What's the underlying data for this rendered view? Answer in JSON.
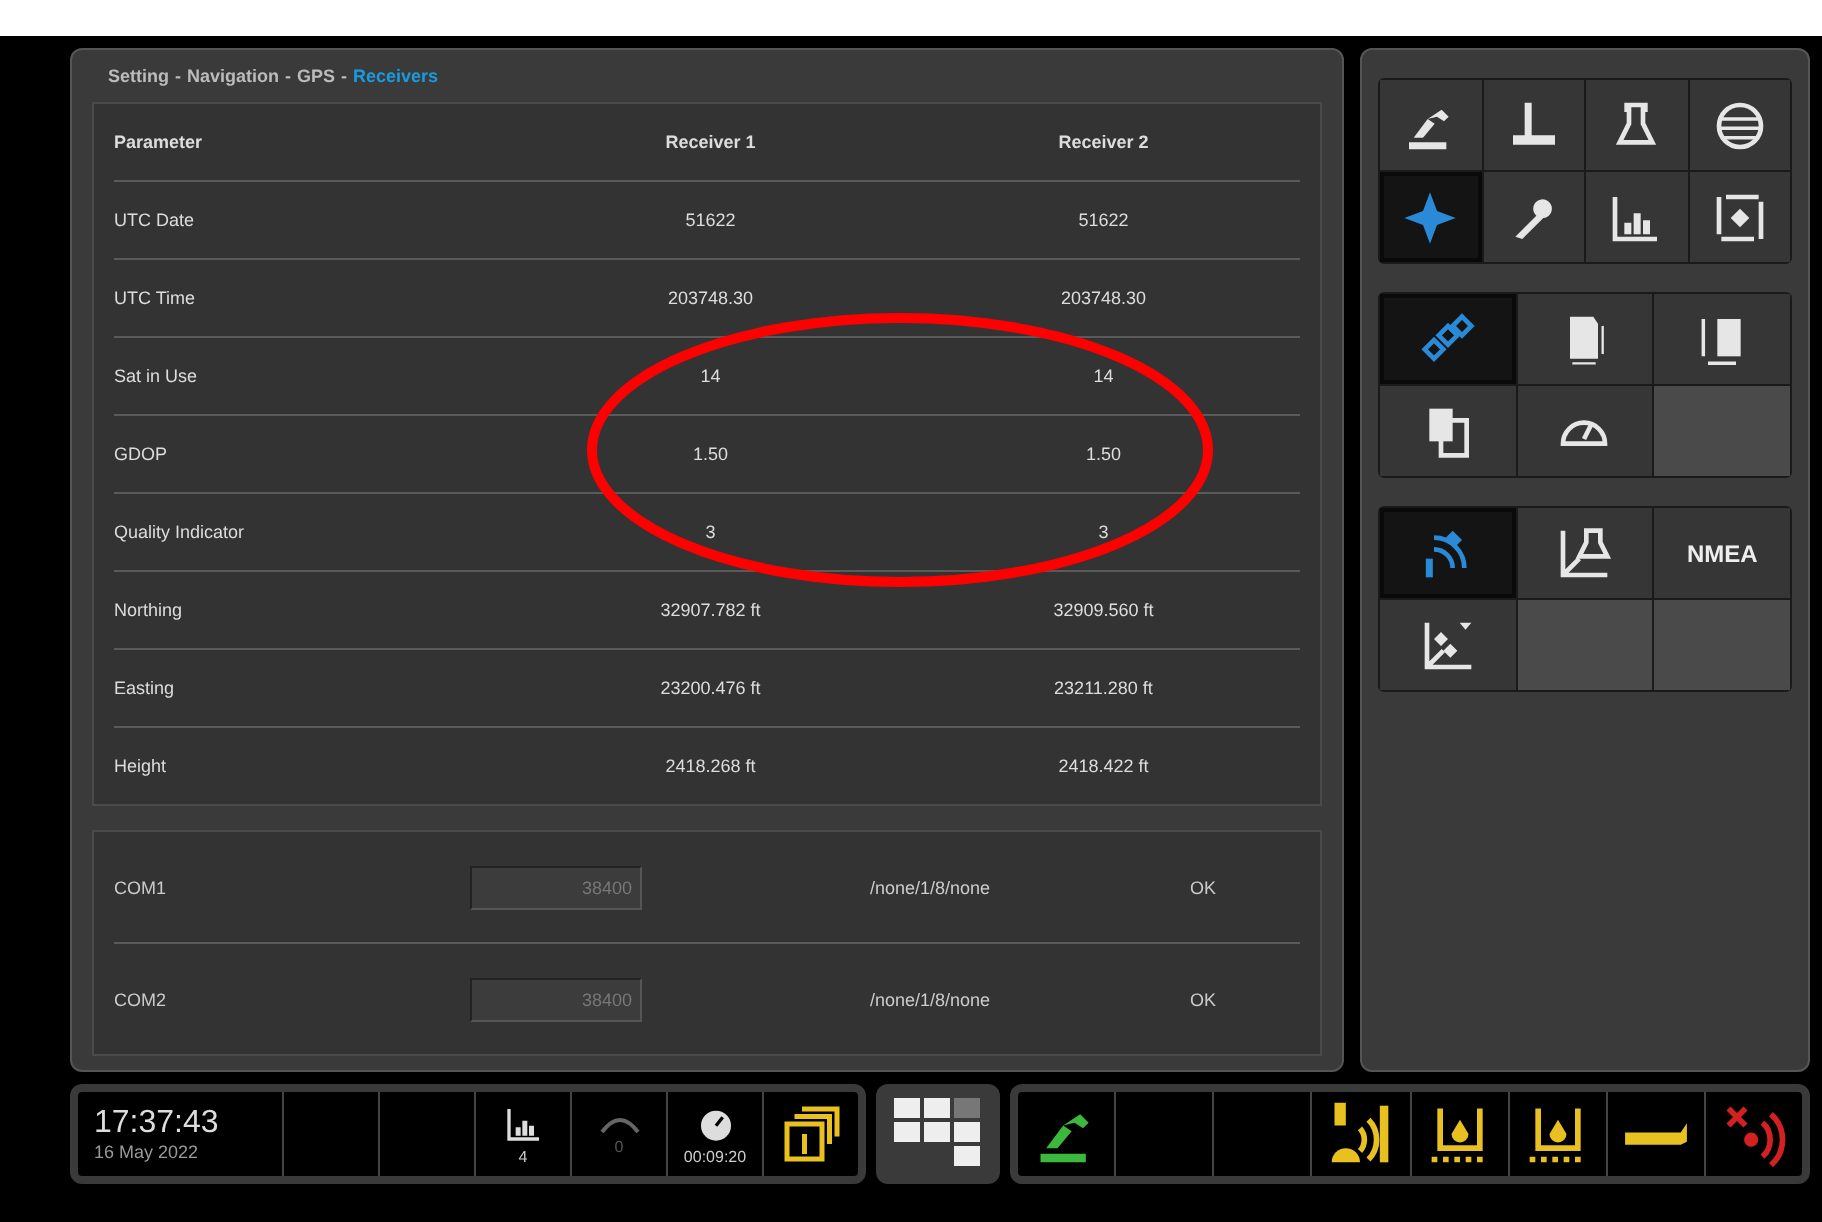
{
  "breadcrumb": {
    "separator": "-",
    "items": [
      {
        "label": "Setting",
        "current": false
      },
      {
        "label": "Navigation",
        "current": false
      },
      {
        "label": "GPS",
        "current": false
      },
      {
        "label": "Receivers",
        "current": true
      }
    ]
  },
  "table": {
    "columns": [
      "Parameter",
      "Receiver 1",
      "Receiver 2"
    ],
    "rows": [
      {
        "parameter": "UTC Date",
        "values": [
          "51622",
          "51622"
        ]
      },
      {
        "parameter": "UTC Time",
        "values": [
          "203748.30",
          "203748.30"
        ]
      },
      {
        "parameter": "Sat in Use",
        "values": [
          "14",
          "14"
        ]
      },
      {
        "parameter": "GDOP",
        "values": [
          "1.50",
          "1.50"
        ]
      },
      {
        "parameter": "Quality Indicator",
        "values": [
          "3",
          "3"
        ]
      },
      {
        "parameter": "Northing",
        "values": [
          "32907.782 ft",
          "32909.560 ft"
        ]
      },
      {
        "parameter": "Easting",
        "values": [
          "23200.476 ft",
          "23211.280 ft"
        ]
      },
      {
        "parameter": "Height",
        "values": [
          "2418.268 ft",
          "2418.422 ft"
        ]
      }
    ]
  },
  "ports": [
    {
      "name": "COM1",
      "baud": "38400",
      "settings": "/none/1/8/none",
      "status": "OK"
    },
    {
      "name": "COM2",
      "baud": "38400",
      "settings": "/none/1/8/none",
      "status": "OK"
    }
  ],
  "menu_groups": [
    {
      "buttons": [
        {
          "kind": "icon",
          "selected": false
        },
        {
          "kind": "icon",
          "selected": false
        },
        {
          "kind": "icon",
          "selected": false
        },
        {
          "kind": "icon",
          "selected": false
        },
        {
          "kind": "icon",
          "selected": true
        },
        {
          "kind": "icon",
          "selected": false
        },
        {
          "kind": "icon",
          "selected": false
        },
        {
          "kind": "icon",
          "selected": false
        }
      ]
    },
    {
      "buttons": [
        {
          "kind": "icon",
          "selected": true
        },
        {
          "kind": "icon",
          "selected": false
        },
        {
          "kind": "icon",
          "selected": false
        },
        {
          "kind": "icon",
          "selected": false
        },
        {
          "kind": "icon",
          "selected": false
        },
        {
          "kind": "empty"
        }
      ]
    },
    {
      "buttons": [
        {
          "kind": "icon",
          "selected": true
        },
        {
          "kind": "icon",
          "selected": false
        },
        {
          "kind": "text",
          "label": "NMEA",
          "selected": false
        },
        {
          "kind": "icon",
          "selected": false
        },
        {
          "kind": "empty"
        },
        {
          "kind": "empty"
        }
      ]
    }
  ],
  "status_bar": {
    "time": "17:37:43",
    "date": "16 May 2022",
    "left_slots": [
      {
        "kind": "empty"
      },
      {
        "kind": "empty"
      },
      {
        "kind": "icon",
        "value": "4",
        "disabled": false
      },
      {
        "kind": "icon",
        "value": "0",
        "disabled": true
      },
      {
        "kind": "icon",
        "value": "00:09:20",
        "disabled": false
      },
      {
        "kind": "icon",
        "color": "#e8c020"
      }
    ],
    "right_slots": [
      {
        "kind": "icon",
        "color": "#3cb83c"
      },
      {
        "kind": "empty"
      },
      {
        "kind": "empty"
      },
      {
        "kind": "icon",
        "color": "#e8c020"
      },
      {
        "kind": "icon",
        "color": "#e8c020"
      },
      {
        "kind": "icon",
        "color": "#e8c020"
      },
      {
        "kind": "icon",
        "color": "#e8c020"
      },
      {
        "kind": "icon",
        "color": "#d42020"
      }
    ]
  },
  "annotation": {
    "kind": "ellipse",
    "color": "#ff0000"
  }
}
